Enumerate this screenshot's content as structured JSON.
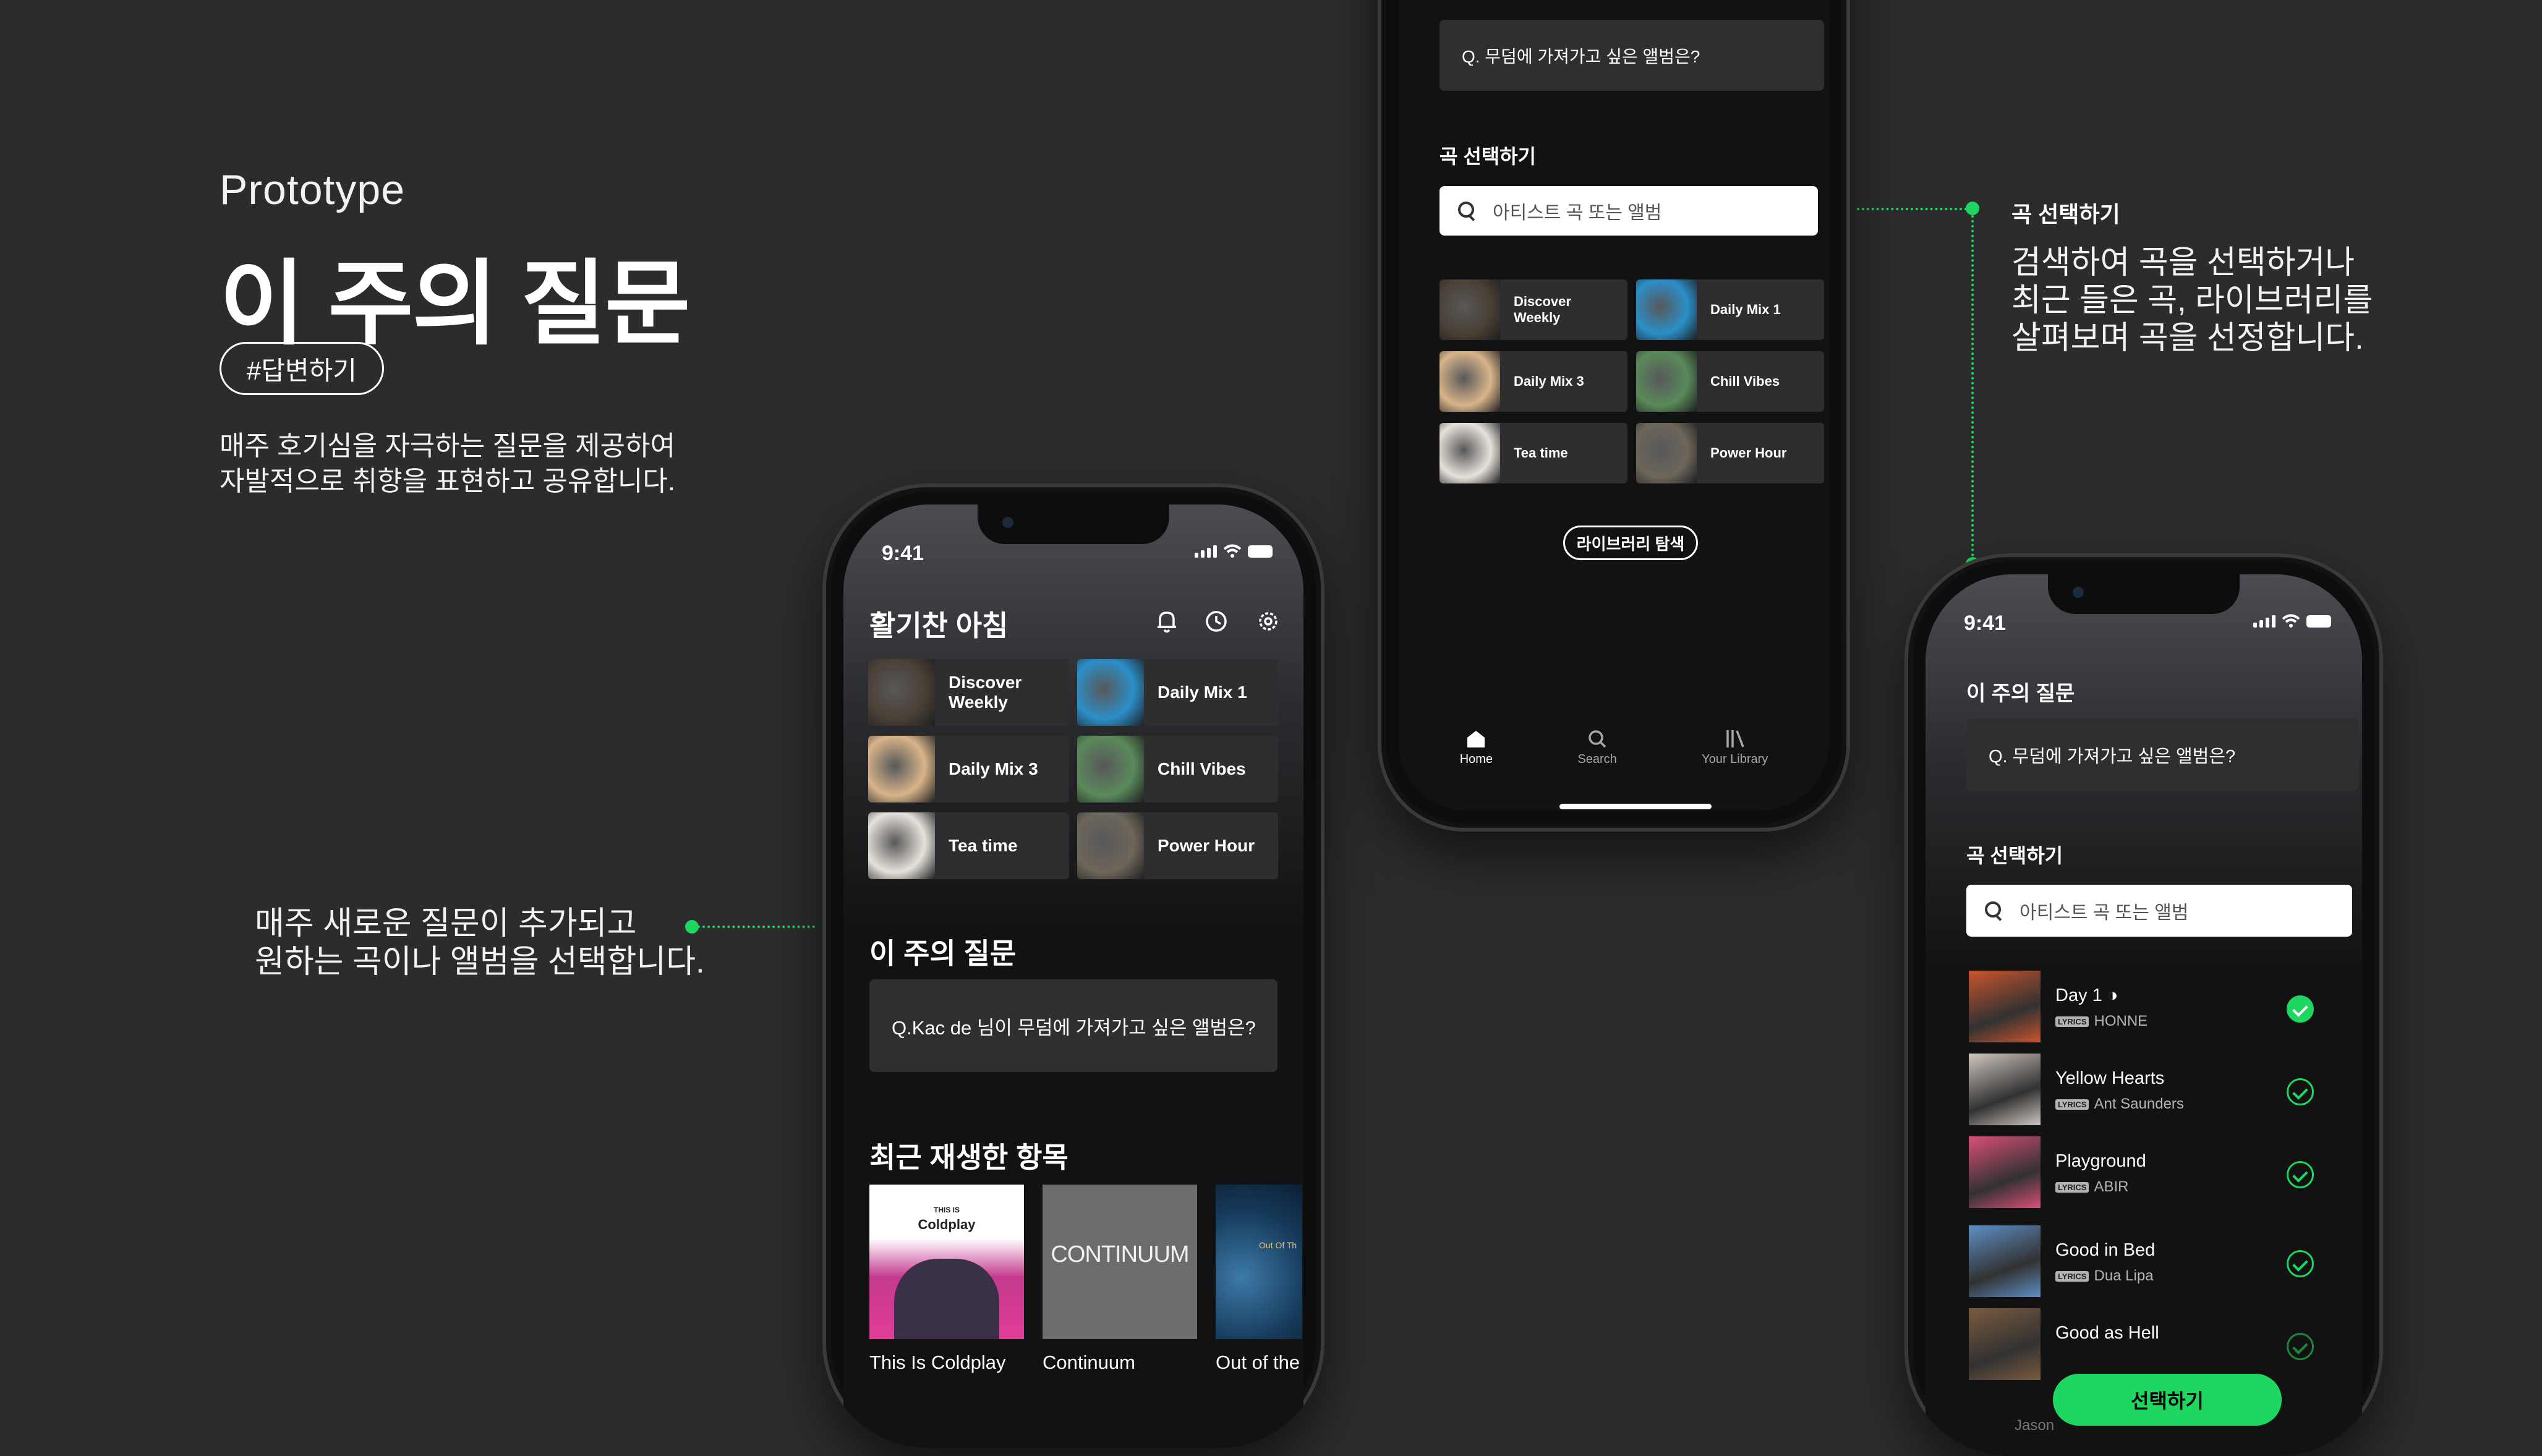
{
  "slide": {
    "label": "Prototype",
    "title": "이 주의 질문",
    "tag": "#답변하기",
    "description": "매주 호기심을 자극하는 질문을 제공하여\n자발적으로 취향을 표현하고 공유합니다.",
    "callout_left": "매주 새로운 질문이 추가되고\n원하는 곡이나 앨범을 선택합니다.",
    "callout_right_title": "곡 선택하기",
    "callout_right": "검색하여 곡을 선택하거나\n최근 들은 곡, 라이브러리를\n살펴보며 곡을 선정합니다."
  },
  "colors": {
    "accent": "#1ed760",
    "background": "#2c2c2c",
    "tile": "#2e2e30"
  },
  "home_phone": {
    "time": "9:41",
    "greeting": "활기찬 아침",
    "icons": [
      "bell-icon",
      "history-icon",
      "settings-icon"
    ],
    "tiles": [
      {
        "label": "Discover\nWeekly",
        "color": "#4a4036"
      },
      {
        "label": "Daily Mix 1",
        "color": "#2b8fc8"
      },
      {
        "label": "Daily Mix 3",
        "color": "#d8b48a"
      },
      {
        "label": "Chill Vibes",
        "color": "#5a8a5a"
      },
      {
        "label": "Tea time",
        "color": "#e6e1da"
      },
      {
        "label": "Power Hour",
        "color": "#6d665a"
      }
    ],
    "weekly_title": "이 주의 질문",
    "weekly_question": "Q.Kac de 님이 무덤에 가져가고 싶은 앨범은?",
    "recent_title": "최근 재생한 항목",
    "recent": [
      {
        "caption": "This Is Coldplay",
        "cover_top": "THIS IS",
        "cover_name": "Coldplay"
      },
      {
        "caption": "Continuum",
        "cover_name": "CONTINUUM"
      },
      {
        "caption": "Out of the I",
        "cover_name": "Out Of Th"
      }
    ]
  },
  "top_phone": {
    "question": "Q. 무덤에 가져가고 싶은 앨범은?",
    "select_title": "곡 선택하기",
    "search_placeholder": "아티스트 곡 또는 앨범",
    "tiles": [
      {
        "label": "Discover\nWeekly",
        "color": "#4a4036"
      },
      {
        "label": "Daily Mix 1",
        "color": "#2b8fc8"
      },
      {
        "label": "Daily Mix 3",
        "color": "#d8b48a"
      },
      {
        "label": "Chill Vibes",
        "color": "#5a8a5a"
      },
      {
        "label": "Tea time",
        "color": "#e6e1da"
      },
      {
        "label": "Power Hour",
        "color": "#6d665a"
      }
    ],
    "library_button": "라이브러리 탐색",
    "nav": [
      {
        "label": "Home",
        "icon": "home-icon"
      },
      {
        "label": "Search",
        "icon": "search-icon"
      },
      {
        "label": "Your Library",
        "icon": "library-icon"
      }
    ]
  },
  "right_phone": {
    "time": "9:41",
    "header": "이 주의 질문",
    "question": "Q. 무덤에 가져가고 싶은 앨범은?",
    "select_title": "곡 선택하기",
    "search_placeholder": "아티스트 곡 또는 앨범",
    "songs": [
      {
        "title": "Day 1 ◑",
        "artist": "HONNE",
        "badge": "LYRICS",
        "selected": true,
        "color": "#c9542e"
      },
      {
        "title": "Yellow Hearts",
        "artist": "Ant Saunders",
        "badge": "LYRICS",
        "selected": false,
        "color": "#cfc6c0"
      },
      {
        "title": "Playground",
        "artist": "ABIR",
        "badge": "LYRICS",
        "selected": false,
        "color": "#d94f77"
      },
      {
        "title": "Good in Bed",
        "artist": "Dua Lipa",
        "badge": "LYRICS",
        "selected": false,
        "color": "#5e8fc4"
      },
      {
        "title": "Good as Hell",
        "artist": "",
        "badge": "",
        "selected": false,
        "color": "#7a5b3f"
      }
    ],
    "bottom_peek": "Jason",
    "select_button": "선택하기"
  }
}
